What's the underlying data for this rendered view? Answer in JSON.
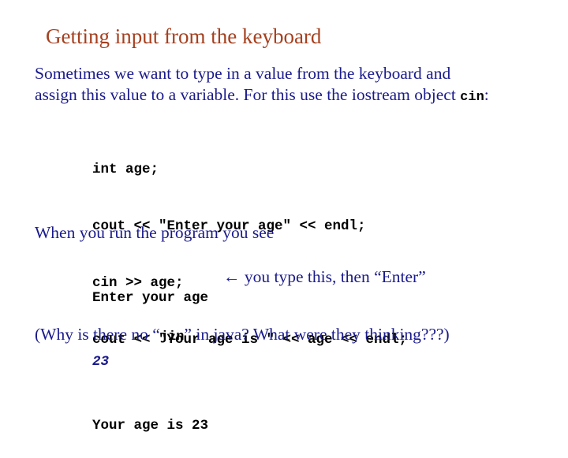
{
  "slide": {
    "title": "Getting input from the keyboard",
    "intro": {
      "line1": "Sometimes we want to type in a value from the keyboard and",
      "line2_prefix": "assign this value to a variable.  For this use the iostream object ",
      "line2_code": "cin",
      "line2_suffix": ":"
    },
    "code_lines": [
      "int age;",
      "cout << \"Enter your age\" << endl;",
      "cin >> age;",
      "cout << \"Your age is \" << age << endl;"
    ],
    "run_intro": "When you run the program you see",
    "output": {
      "prompt": "Enter your age",
      "typed_value": "23",
      "typed_note": "← you type this, then “Enter”",
      "result": "Your age is 23"
    },
    "footer": {
      "prefix": "(Why is there no “",
      "code": "jin",
      "suffix": "” in java?  What were they thinking???)"
    },
    "colors": {
      "title": "#a5401f",
      "body": "#1a1a8c",
      "code": "#000000"
    }
  }
}
